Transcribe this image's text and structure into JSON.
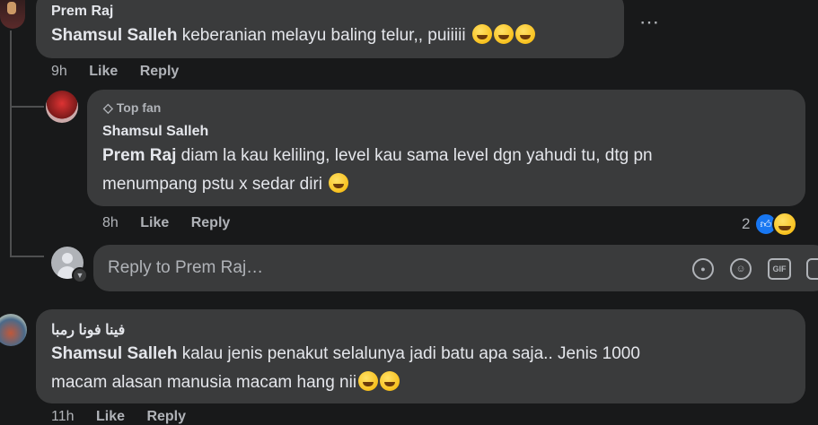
{
  "comment1": {
    "author": "Prem Raj",
    "mention": "Shamsul Salleh",
    "text": "keberanian melayu baling telur,, puiiiii",
    "time": "9h",
    "like": "Like",
    "reply": "Reply",
    "more": "⋯"
  },
  "reply1": {
    "badge": "Top fan",
    "author": "Shamsul Salleh",
    "mention": "Prem Raj",
    "text_line1": "diam la kau keliling, level kau sama level dgn yahudi tu, dtg pn",
    "text_line2": "menumpang pstu x sedar diri",
    "time": "8h",
    "like": "Like",
    "reply": "Reply",
    "reaction_count": "2"
  },
  "reply_box": {
    "placeholder": "Reply to Prem Raj…"
  },
  "comment2": {
    "author": "فينا فونا رمبا",
    "mention": "Shamsul Salleh",
    "text_line1": "kalau jenis penakut selalunya jadi batu apa saja.. Jenis 1000",
    "text_line2": "macam alasan manusia macam hang nii",
    "time": "11h",
    "like": "Like",
    "reply": "Reply"
  },
  "colors": {
    "background": "#18191a",
    "bubble": "#3a3b3c",
    "like_blue": "#1877f2"
  }
}
